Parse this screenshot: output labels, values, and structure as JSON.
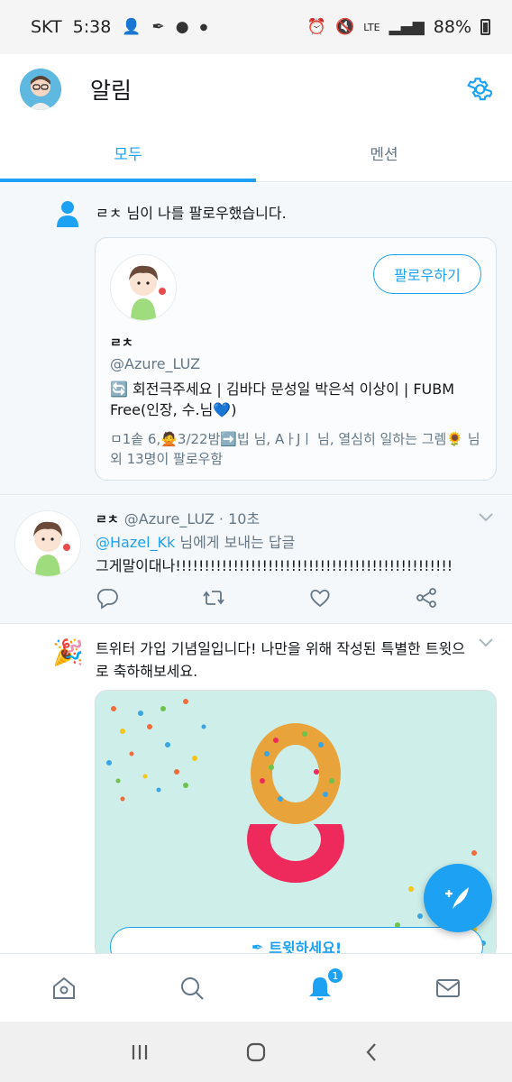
{
  "status_bar": {
    "carrier": "SKT",
    "time": "5:38",
    "network": "LTE",
    "battery": "88%"
  },
  "header": {
    "title": "알림"
  },
  "tabs": [
    {
      "label": "모두",
      "active": true
    },
    {
      "label": "멘션",
      "active": false
    }
  ],
  "follow_notification": {
    "text": "ㄹㅊ 님이 나를 팔로우했습니다.",
    "card": {
      "follow_button": "팔로우하기",
      "name": "ㄹㅊ",
      "handle": "@Azure_LUZ",
      "bio": "🔄 회전극주세요 | 김바다 문성일 박은석 이상이 | FUBM Free(인장, 수.님💙)",
      "followed_by": "ㅁ1솥 6,🙅3/22밤➡️빕 님, AㅏJㅣ 님, 열심히 일하는 그렘🌻 님 외 13명이 팔로우함"
    }
  },
  "reply_tweet": {
    "name": "ㄹㅊ",
    "handle": "@Azure_LUZ",
    "time": "· 10초",
    "reply_mention": "@Hazel_Kk",
    "reply_suffix": " 님에게 보내는 답글",
    "body": "그게말이대나!!!!!!!!!!!!!!!!!!!!!!!!!!!!!!!!!!!!!!!!!!!!!!!!"
  },
  "anniversary": {
    "text": "트위터 가입 기념일입니다! 나만을 위해 작성된 특별한 트윗으로 축하해보세요.",
    "tweet_button": "트윗하세요!"
  },
  "bottom_nav": {
    "notification_badge": "1"
  },
  "colors": {
    "accent": "#1da1f2",
    "secondary_text": "#657786"
  }
}
